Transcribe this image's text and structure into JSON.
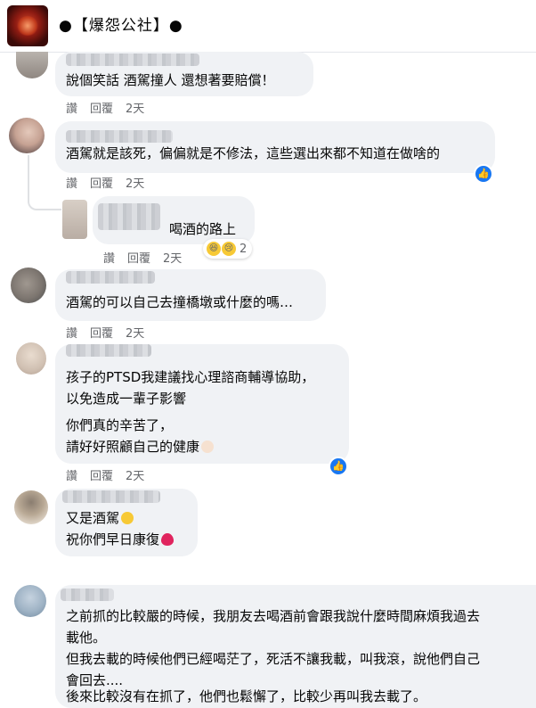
{
  "page": {
    "name": "●【爆怨公社】●"
  },
  "actions": {
    "like": "讚",
    "reply": "回覆"
  },
  "comments": [
    {
      "lines": [
        "說個笑話 酒駕撞人 還想著要賠償！"
      ],
      "time": "2天"
    },
    {
      "lines": [
        "酒駕就是該死，偏偏就是不修法，這些選出來都不知道在做啥的"
      ],
      "time": "2天"
    },
    {
      "lines": [
        "喝酒的路上"
      ],
      "time": "2天",
      "reaction_count": "2"
    },
    {
      "lines": [
        "酒駕的可以自己去撞橋墩或什麼的嗎…"
      ],
      "time": "2天"
    },
    {
      "lines": [
        "孩子的PTSD我建議找心理諮商輔導協助，",
        "以免造成一輩子影響",
        "你們真的辛苦了，",
        "請好好照顧自己的健康"
      ],
      "time": "2天"
    },
    {
      "lines": [
        "又是酒駕",
        "祝你們早日康復"
      ],
      "time": ""
    },
    {
      "lines": [
        "之前抓的比較嚴的時候，我朋友去喝酒前會跟我說什麼時間麻煩我過去",
        "載他。",
        "但我去載的時候他們已經喝茫了，死活不讓我載，叫我滾，說他們自己",
        "會回去....",
        "後來比較沒有在抓了，他們也鬆懈了，比較少再叫我去載了。"
      ],
      "time": ""
    }
  ],
  "colors": {
    "bubble": "#f0f2f5",
    "meta": "#65676b",
    "like_blue": "#1877f2"
  }
}
